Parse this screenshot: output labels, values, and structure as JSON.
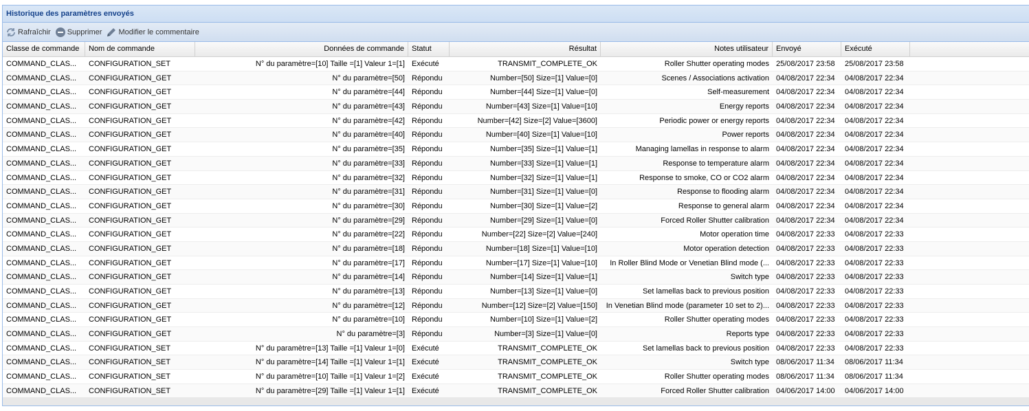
{
  "panel": {
    "title": "Historique des paramètres envoyés"
  },
  "toolbar": {
    "refresh": {
      "label": "Rafraîchir",
      "icon": "refresh-icon"
    },
    "delete": {
      "label": "Supprimer",
      "icon": "minus-circle-icon"
    },
    "edit_comment": {
      "label": "Modifier le commentaire",
      "icon": "pencil-icon"
    }
  },
  "columns": [
    "Classe de commande",
    "Nom de commande",
    "Données de commande",
    "Statut",
    "Résultat",
    "Notes utilisateur",
    "Envoyé",
    "Exécuté"
  ],
  "rows": [
    [
      "COMMAND_CLAS...",
      "CONFIGURATION_SET",
      "N° du paramètre=[10] Taille =[1] Valeur 1=[1]",
      "Exécuté",
      "TRANSMIT_COMPLETE_OK",
      "Roller Shutter operating modes",
      "25/08/2017 23:58",
      "25/08/2017 23:58"
    ],
    [
      "COMMAND_CLAS...",
      "CONFIGURATION_GET",
      "N° du paramètre=[50]",
      "Répondu",
      "Number=[50] Size=[1] Value=[0]",
      "Scenes / Associations activation",
      "04/08/2017 22:34",
      "04/08/2017 22:34"
    ],
    [
      "COMMAND_CLAS...",
      "CONFIGURATION_GET",
      "N° du paramètre=[44]",
      "Répondu",
      "Number=[44] Size=[1] Value=[0]",
      "Self-measurement",
      "04/08/2017 22:34",
      "04/08/2017 22:34"
    ],
    [
      "COMMAND_CLAS...",
      "CONFIGURATION_GET",
      "N° du paramètre=[43]",
      "Répondu",
      "Number=[43] Size=[1] Value=[10]",
      "Energy reports",
      "04/08/2017 22:34",
      "04/08/2017 22:34"
    ],
    [
      "COMMAND_CLAS...",
      "CONFIGURATION_GET",
      "N° du paramètre=[42]",
      "Répondu",
      "Number=[42] Size=[2] Value=[3600]",
      "Periodic power or energy reports",
      "04/08/2017 22:34",
      "04/08/2017 22:34"
    ],
    [
      "COMMAND_CLAS...",
      "CONFIGURATION_GET",
      "N° du paramètre=[40]",
      "Répondu",
      "Number=[40] Size=[1] Value=[10]",
      "Power reports",
      "04/08/2017 22:34",
      "04/08/2017 22:34"
    ],
    [
      "COMMAND_CLAS...",
      "CONFIGURATION_GET",
      "N° du paramètre=[35]",
      "Répondu",
      "Number=[35] Size=[1] Value=[1]",
      "Managing lamellas in response to alarm",
      "04/08/2017 22:34",
      "04/08/2017 22:34"
    ],
    [
      "COMMAND_CLAS...",
      "CONFIGURATION_GET",
      "N° du paramètre=[33]",
      "Répondu",
      "Number=[33] Size=[1] Value=[1]",
      "Response to temperature alarm",
      "04/08/2017 22:34",
      "04/08/2017 22:34"
    ],
    [
      "COMMAND_CLAS...",
      "CONFIGURATION_GET",
      "N° du paramètre=[32]",
      "Répondu",
      "Number=[32] Size=[1] Value=[1]",
      "Response to smoke, CO or CO2 alarm",
      "04/08/2017 22:34",
      "04/08/2017 22:34"
    ],
    [
      "COMMAND_CLAS...",
      "CONFIGURATION_GET",
      "N° du paramètre=[31]",
      "Répondu",
      "Number=[31] Size=[1] Value=[0]",
      "Response to flooding alarm",
      "04/08/2017 22:34",
      "04/08/2017 22:34"
    ],
    [
      "COMMAND_CLAS...",
      "CONFIGURATION_GET",
      "N° du paramètre=[30]",
      "Répondu",
      "Number=[30] Size=[1] Value=[2]",
      "Response to general alarm",
      "04/08/2017 22:34",
      "04/08/2017 22:34"
    ],
    [
      "COMMAND_CLAS...",
      "CONFIGURATION_GET",
      "N° du paramètre=[29]",
      "Répondu",
      "Number=[29] Size=[1] Value=[0]",
      "Forced Roller Shutter calibration",
      "04/08/2017 22:34",
      "04/08/2017 22:34"
    ],
    [
      "COMMAND_CLAS...",
      "CONFIGURATION_GET",
      "N° du paramètre=[22]",
      "Répondu",
      "Number=[22] Size=[2] Value=[240]",
      "Motor operation time",
      "04/08/2017 22:33",
      "04/08/2017 22:33"
    ],
    [
      "COMMAND_CLAS...",
      "CONFIGURATION_GET",
      "N° du paramètre=[18]",
      "Répondu",
      "Number=[18] Size=[1] Value=[10]",
      "Motor operation detection",
      "04/08/2017 22:33",
      "04/08/2017 22:33"
    ],
    [
      "COMMAND_CLAS...",
      "CONFIGURATION_GET",
      "N° du paramètre=[17]",
      "Répondu",
      "Number=[17] Size=[1] Value=[10]",
      "In Roller Blind Mode or Venetian Blind mode (...",
      "04/08/2017 22:33",
      "04/08/2017 22:33"
    ],
    [
      "COMMAND_CLAS...",
      "CONFIGURATION_GET",
      "N° du paramètre=[14]",
      "Répondu",
      "Number=[14] Size=[1] Value=[1]",
      "Switch type",
      "04/08/2017 22:33",
      "04/08/2017 22:33"
    ],
    [
      "COMMAND_CLAS...",
      "CONFIGURATION_GET",
      "N° du paramètre=[13]",
      "Répondu",
      "Number=[13] Size=[1] Value=[0]",
      "Set lamellas back to previous position",
      "04/08/2017 22:33",
      "04/08/2017 22:33"
    ],
    [
      "COMMAND_CLAS...",
      "CONFIGURATION_GET",
      "N° du paramètre=[12]",
      "Répondu",
      "Number=[12] Size=[2] Value=[150]",
      "In Venetian Blind mode (parameter 10 set to 2)...",
      "04/08/2017 22:33",
      "04/08/2017 22:33"
    ],
    [
      "COMMAND_CLAS...",
      "CONFIGURATION_GET",
      "N° du paramètre=[10]",
      "Répondu",
      "Number=[10] Size=[1] Value=[2]",
      "Roller Shutter operating modes",
      "04/08/2017 22:33",
      "04/08/2017 22:33"
    ],
    [
      "COMMAND_CLAS...",
      "CONFIGURATION_GET",
      "N° du paramètre=[3]",
      "Répondu",
      "Number=[3] Size=[1] Value=[0]",
      "Reports type",
      "04/08/2017 22:33",
      "04/08/2017 22:33"
    ],
    [
      "COMMAND_CLAS...",
      "CONFIGURATION_SET",
      "N° du paramètre=[13] Taille =[1] Valeur 1=[0]",
      "Exécuté",
      "TRANSMIT_COMPLETE_OK",
      "Set lamellas back to previous position",
      "04/08/2017 22:33",
      "04/08/2017 22:33"
    ],
    [
      "COMMAND_CLAS...",
      "CONFIGURATION_SET",
      "N° du paramètre=[14] Taille =[1] Valeur 1=[1]",
      "Exécuté",
      "TRANSMIT_COMPLETE_OK",
      "Switch type",
      "08/06/2017 11:34",
      "08/06/2017 11:34"
    ],
    [
      "COMMAND_CLAS...",
      "CONFIGURATION_SET",
      "N° du paramètre=[10] Taille =[1] Valeur 1=[2]",
      "Exécuté",
      "TRANSMIT_COMPLETE_OK",
      "Roller Shutter operating modes",
      "08/06/2017 11:34",
      "08/06/2017 11:34"
    ],
    [
      "COMMAND_CLAS...",
      "CONFIGURATION_SET",
      "N° du paramètre=[29] Taille =[1] Valeur 1=[1]",
      "Exécuté",
      "TRANSMIT_COMPLETE_OK",
      "Forced Roller Shutter calibration",
      "04/06/2017 14:00",
      "04/06/2017 14:00"
    ]
  ]
}
